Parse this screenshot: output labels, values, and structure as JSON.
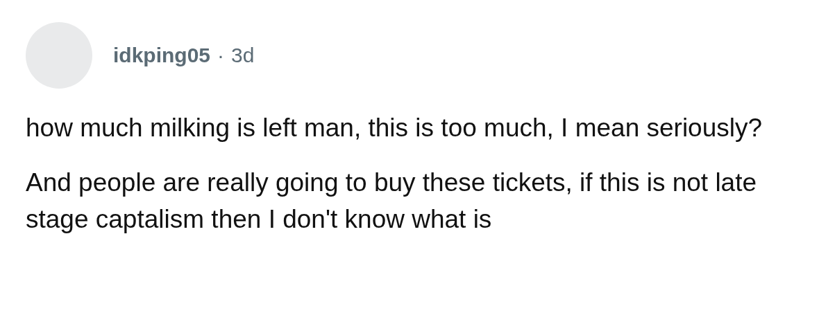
{
  "comment": {
    "author": "idkping05",
    "separator": "·",
    "age": "3d",
    "paragraphs": [
      "how much milking is left man, this is too much, I mean seriously?",
      "And people are really going to buy these tickets, if this is not late stage captalism then I don't know what is"
    ]
  }
}
